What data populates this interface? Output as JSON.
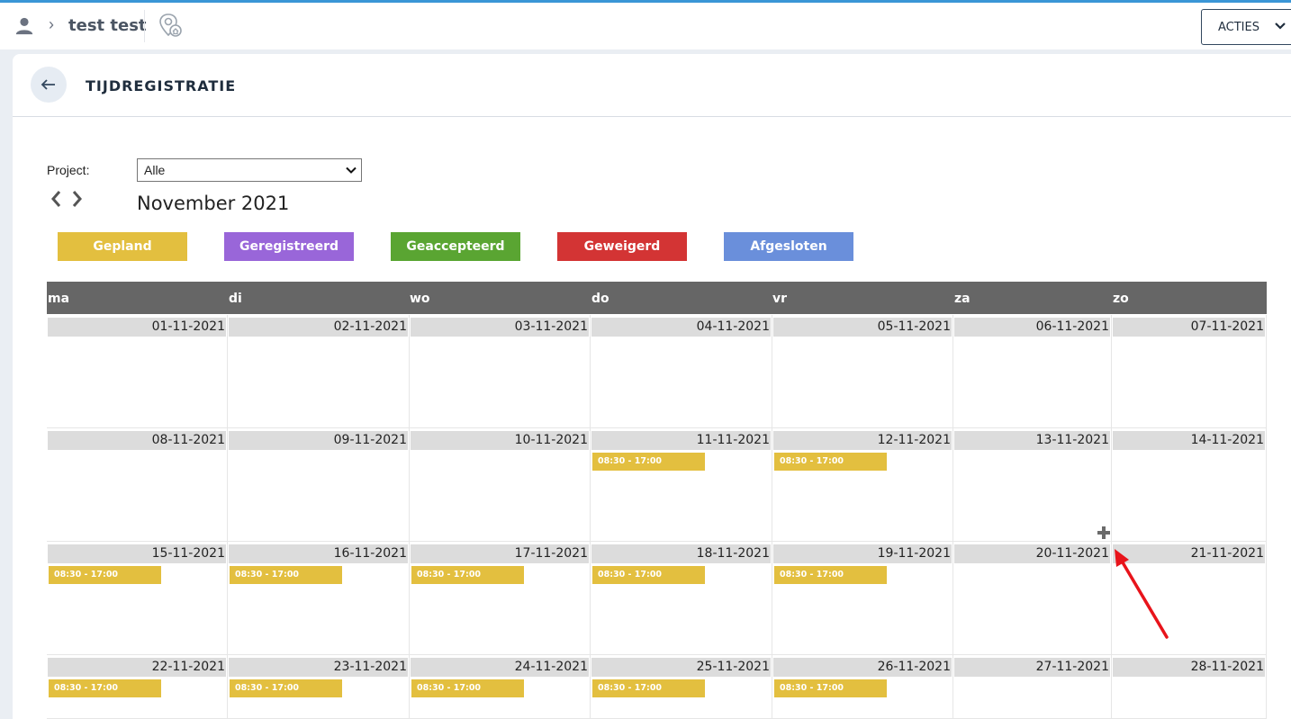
{
  "header": {
    "breadcrumb": "test test",
    "actions_label": "ACTIES"
  },
  "page": {
    "title": "TIJDREGISTRATIE"
  },
  "filters": {
    "project_label": "Project:",
    "project_value": "Alle"
  },
  "calendar": {
    "month": "November 2021",
    "day_names": [
      "ma",
      "di",
      "wo",
      "do",
      "vr",
      "za",
      "zo"
    ],
    "legend": [
      {
        "label": "Gepland",
        "color": "#e3bf3f"
      },
      {
        "label": "Geregistreerd",
        "color": "#9966d9"
      },
      {
        "label": "Geaccepteerd",
        "color": "#5aa532"
      },
      {
        "label": "Geweigerd",
        "color": "#d33434"
      },
      {
        "label": "Afgesloten",
        "color": "#6a8fdb"
      }
    ],
    "weeks": [
      [
        {
          "date": "01-11-2021",
          "events": []
        },
        {
          "date": "02-11-2021",
          "events": []
        },
        {
          "date": "03-11-2021",
          "events": []
        },
        {
          "date": "04-11-2021",
          "events": []
        },
        {
          "date": "05-11-2021",
          "events": []
        },
        {
          "date": "06-11-2021",
          "events": []
        },
        {
          "date": "07-11-2021",
          "events": []
        }
      ],
      [
        {
          "date": "08-11-2021",
          "events": []
        },
        {
          "date": "09-11-2021",
          "events": []
        },
        {
          "date": "10-11-2021",
          "events": []
        },
        {
          "date": "11-11-2021",
          "events": [
            "08:30 - 17:00"
          ]
        },
        {
          "date": "12-11-2021",
          "events": [
            "08:30 - 17:00"
          ]
        },
        {
          "date": "13-11-2021",
          "events": []
        },
        {
          "date": "14-11-2021",
          "events": []
        }
      ],
      [
        {
          "date": "15-11-2021",
          "events": [
            "08:30 - 17:00"
          ]
        },
        {
          "date": "16-11-2021",
          "events": [
            "08:30 - 17:00"
          ]
        },
        {
          "date": "17-11-2021",
          "events": [
            "08:30 - 17:00"
          ]
        },
        {
          "date": "18-11-2021",
          "events": [
            "08:30 - 17:00"
          ]
        },
        {
          "date": "19-11-2021",
          "events": [
            "08:30 - 17:00"
          ]
        },
        {
          "date": "20-11-2021",
          "events": []
        },
        {
          "date": "21-11-2021",
          "events": []
        }
      ],
      [
        {
          "date": "22-11-2021",
          "events": [
            "08:30 - 17:00"
          ]
        },
        {
          "date": "23-11-2021",
          "events": [
            "08:30 - 17:00"
          ]
        },
        {
          "date": "24-11-2021",
          "events": [
            "08:30 - 17:00"
          ]
        },
        {
          "date": "25-11-2021",
          "events": [
            "08:30 - 17:00"
          ]
        },
        {
          "date": "26-11-2021",
          "events": [
            "08:30 - 17:00"
          ]
        },
        {
          "date": "27-11-2021",
          "events": []
        },
        {
          "date": "28-11-2021",
          "events": []
        }
      ]
    ]
  },
  "colors": {
    "accent_line": "#3a96d6",
    "header_bg": "#666666",
    "date_bar": "#dcdcdc",
    "annotation_arrow": "#e8141b"
  },
  "icons": {
    "user": "person-icon",
    "location": "location-home-icon",
    "back": "arrow-left-icon",
    "prev": "chevron-left-icon",
    "next": "chevron-right-icon",
    "add": "plus-icon"
  }
}
